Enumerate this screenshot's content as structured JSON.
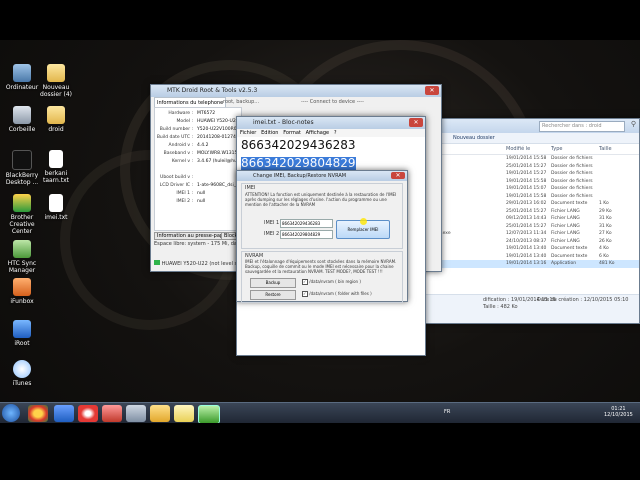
{
  "desktop_icons": [
    {
      "label": "Ordinateur",
      "name": "computer"
    },
    {
      "label": "Nouveau dossier (4)",
      "name": "folder"
    },
    {
      "label": "Corbeille",
      "name": "recycle-bin"
    },
    {
      "label": "droid",
      "name": "folder"
    },
    {
      "label": "BlackBerry Desktop ...",
      "name": "blackberry"
    },
    {
      "label": "berkani taarn.txt",
      "name": "text-file"
    },
    {
      "label": "Brother Creative Center",
      "name": "brother"
    },
    {
      "label": "imei.txt",
      "name": "text-file"
    },
    {
      "label": "HTC Sync Manager",
      "name": "htc"
    },
    {
      "label": "iFunbox",
      "name": "ifunbox"
    },
    {
      "label": "iRoot",
      "name": "iroot"
    },
    {
      "label": "iTunes",
      "name": "itunes"
    }
  ],
  "tool_window": {
    "title": "MTK Droid Root & Tools v2.5.3",
    "tab_info": "Informations du telephone",
    "tab_root": "root, backup...",
    "connected": "---- Connect to device ----",
    "rows": [
      {
        "k": "Hardware :",
        "v": "MT6572"
      },
      {
        "k": "Model :",
        "v": "HUAWEI Y520-U22"
      },
      {
        "k": "Build number :",
        "v": "Y520-U22V100R00"
      },
      {
        "k": "Build date UTC :",
        "v": "20141208-012740"
      },
      {
        "k": "Android v :",
        "v": "4.4.2"
      },
      {
        "k": "Baseband v :",
        "v": "MOLY.WR8.W1315 2014/11/11 17:44"
      },
      {
        "k": "Kernel v :",
        "v": "3.4.67 (huleil@huleil SMP Tue Dec 9 05"
      }
    ],
    "rows2": [
      {
        "k": "Uboot build v :",
        "v": ""
      },
      {
        "k": "LCD Driver IC :",
        "v": "1-ate-9608C_dsi_vdo"
      },
      {
        "k": "IMEI 1 :",
        "v": "null"
      },
      {
        "k": "IMEI 2 :",
        "v": "null"
      }
    ],
    "btn_info": "Information au presse-papiers",
    "btn_blocks": "Blocks Map",
    "status_line": "Espace libre: system - 175 Mi, data - 1.7G",
    "status_bar": "HUAWEI Y520-U22 (not level shell)"
  },
  "notepad": {
    "title": "imei.txt - Bloc-notes",
    "menu": [
      "Fichier",
      "Edition",
      "Format",
      "Affichage",
      "?"
    ],
    "line1": "866342029436283",
    "line2": "866342029804829"
  },
  "dialog": {
    "title": "Change IMEI, Backup/Restore NVRAM",
    "section_imei": "IMEI",
    "attention": "ATTENTION! La fonction est uniquement destinée à la restauration de l'IMEI après dumping sur les réglages d'usine. l'action du programme ou une mention de l'attacher de la NVRAM",
    "imei1_label": "IMEI 1",
    "imei1_value": "866342029436283",
    "imei2_label": "IMEI 2",
    "imei2_value": "866342029804829",
    "replace_btn": "Remplacer IMEI",
    "section_nvram": "NVRAM",
    "nvram_text": "IMEI et l'étalonnage d'équipements sont stockées dans la mémoire NVRAM. Backup, coquille de commit ou le mode IMEI est nécessaire pour la chaine sauvegardée et la restauration NVRAM. TEST MODE?, MODE TEST !!!",
    "backup_btn": "Backup",
    "restore_btn": "Restore",
    "cb1": "/data/nvram   ( bin region )",
    "cb2": "/data/nvram   ( folder with files )"
  },
  "explorer": {
    "search": "Rechercher dans : droid",
    "new_folder": "Nouveau dossier",
    "col_date": "Modifié le",
    "col_type": "Type",
    "col_size": "Taille",
    "rows": [
      {
        "date": "19/01/2014 15:58",
        "type": "Dossier de fichiers",
        "size": ""
      },
      {
        "date": "25/01/2014 15:27",
        "type": "Dossier de fichiers",
        "size": ""
      },
      {
        "date": "19/01/2014 15:27",
        "type": "Dossier de fichiers",
        "size": ""
      },
      {
        "date": "19/01/2014 15:58",
        "type": "Dossier de fichiers",
        "size": ""
      },
      {
        "date": "19/01/2014 15:07",
        "type": "Dossier de fichiers",
        "size": ""
      },
      {
        "date": "19/01/2014 15:58",
        "type": "Dossier de fichiers",
        "size": ""
      },
      {
        "date": "29/01/2013 16:02",
        "type": "Document texte",
        "size": "1 Ko"
      },
      {
        "date": "25/01/2014 15:27",
        "type": "Fichier LANG",
        "size": "29 Ko"
      },
      {
        "date": "09/12/2013 14:43",
        "type": "Fichier LANG",
        "size": "31 Ko"
      },
      {
        "date": "25/01/2014 15:27",
        "type": "Fichier LANG",
        "size": "31 Ko"
      },
      {
        "date": "12/07/2013 11:34",
        "type": "Fichier LANG",
        "size": "27 Ko"
      },
      {
        "date": "24/10/2013 08:37",
        "type": "Fichier LANG",
        "size": "26 Ko"
      },
      {
        "date": "19/01/2014 13:40",
        "type": "Document texte",
        "size": "4 Ko"
      },
      {
        "date": "19/01/2014 13:40",
        "type": "Document texte",
        "size": "6 Ko"
      },
      {
        "date": "19/01/2014 13:16",
        "type": "Application",
        "size": "481 Ko"
      }
    ],
    "file_names": [
      "txt",
      "ng",
      "ng",
      "ng",
      "idTools.exe"
    ],
    "status1": "Date de création : 12/10/2015 05:10",
    "status2": "Taille : 482 Ko",
    "status3": "dification : 19/01/2014 13:16"
  },
  "taskbar": {
    "lang": "FR",
    "time": "01:21",
    "date": "12/10/2015"
  }
}
